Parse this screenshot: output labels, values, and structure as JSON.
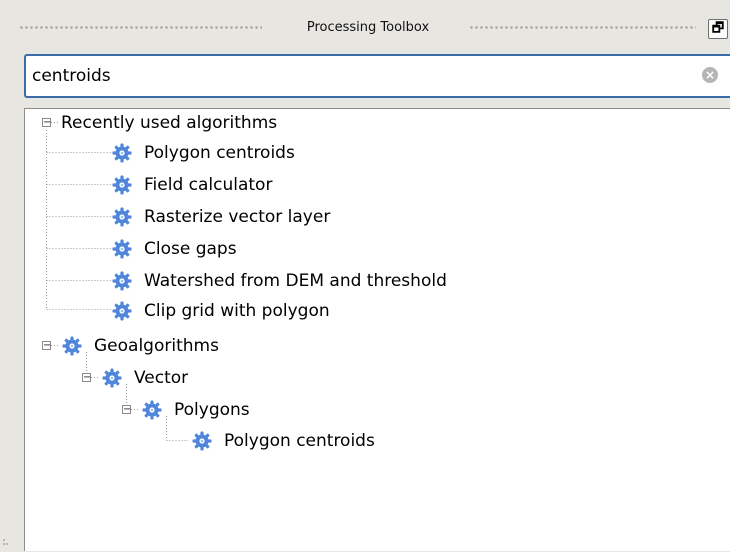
{
  "panel": {
    "title": "Processing Toolbox",
    "float_button": "🗗",
    "close_button": "✕"
  },
  "search": {
    "value": "centroids",
    "placeholder": "",
    "clear_icon": "×"
  },
  "tree": {
    "recent": {
      "label": "Recently used algorithms",
      "expander": "−",
      "items": [
        {
          "label": "Polygon centroids",
          "icon": "gear-icon"
        },
        {
          "label": "Field calculator",
          "icon": "gear-icon"
        },
        {
          "label": "Rasterize vector layer",
          "icon": "gear-icon"
        },
        {
          "label": "Close gaps",
          "icon": "gear-icon"
        },
        {
          "label": "Watershed from DEM and threshold",
          "icon": "gear-icon"
        },
        {
          "label": "Clip grid with polygon",
          "icon": "gear-icon"
        }
      ]
    },
    "geo": {
      "label": "Geoalgorithms",
      "expander": "−",
      "vector": {
        "label": "Vector",
        "expander": "−",
        "polygons": {
          "label": "Polygons",
          "expander": "−",
          "items": [
            {
              "label": "Polygon centroids",
              "icon": "gear-icon"
            }
          ]
        }
      }
    }
  },
  "colors": {
    "gear": "#4f86d9",
    "focus_border": "#3a6ea5"
  }
}
